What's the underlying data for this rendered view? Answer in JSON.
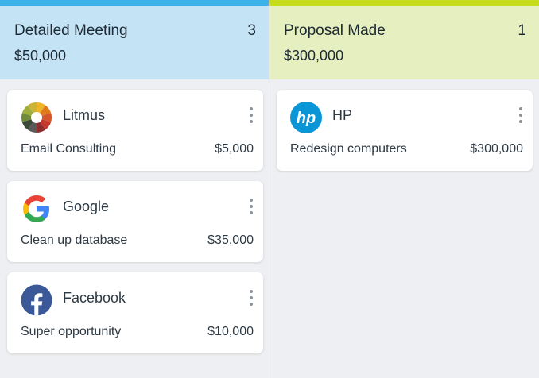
{
  "columns": [
    {
      "title": "Detailed Meeting",
      "count": "3",
      "total": "$50,000",
      "header_bg": "#c4e4f6",
      "strip_color": "#3fb1ea",
      "cards": [
        {
          "company": "Litmus",
          "description": "Email Consulting",
          "amount": "$5,000",
          "icon": "litmus-logo-icon"
        },
        {
          "company": "Google",
          "description": "Clean up database",
          "amount": "$35,000",
          "icon": "google-logo-icon"
        },
        {
          "company": "Facebook",
          "description": "Super opportunity",
          "amount": "$10,000",
          "icon": "facebook-logo-icon"
        }
      ]
    },
    {
      "title": "Proposal Made",
      "count": "1",
      "total": "$300,000",
      "header_bg": "#e6efbf",
      "strip_color": "#c6dc1d",
      "cards": [
        {
          "company": "HP",
          "description": "Redesign computers",
          "amount": "$300,000",
          "icon": "hp-logo-icon"
        }
      ]
    }
  ],
  "card_menu_icon": "more-vertical-icon"
}
